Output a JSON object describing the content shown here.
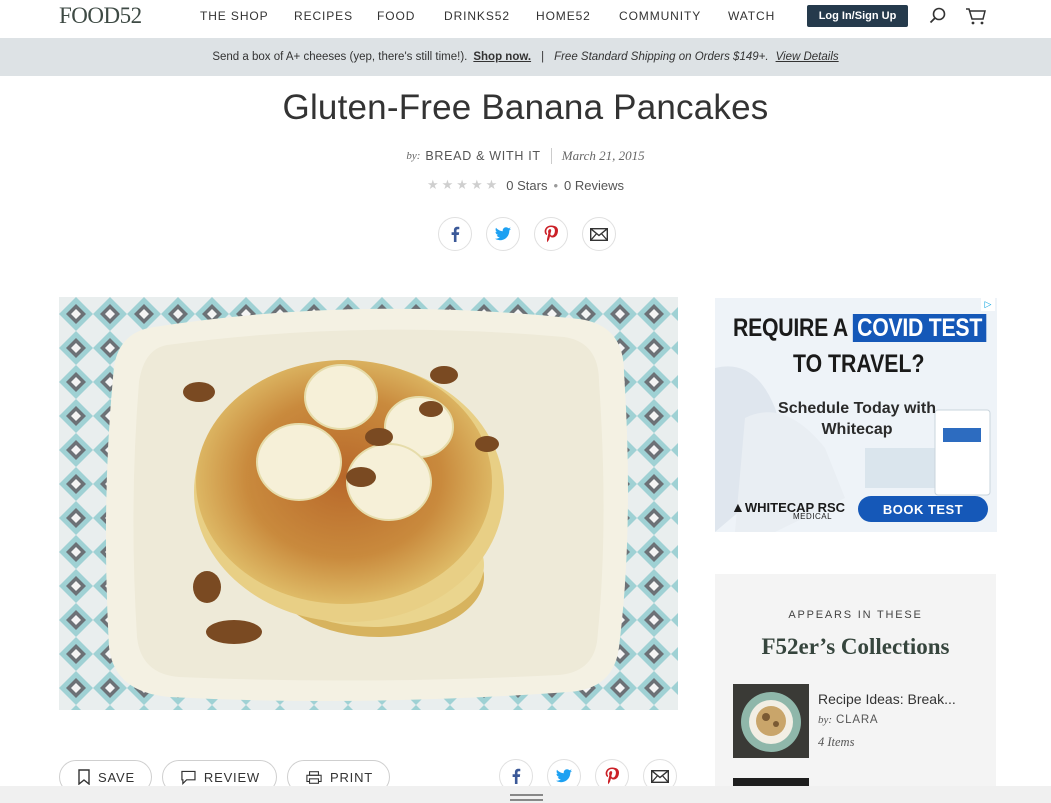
{
  "header": {
    "logo": "FOOD52",
    "nav": [
      "THE SHOP",
      "RECIPES",
      "FOOD",
      "DRINKS52",
      "HOME52",
      "COMMUNITY",
      "WATCH"
    ],
    "login_label": "Log In/Sign Up",
    "icons": [
      "search-icon",
      "cart-icon"
    ]
  },
  "promo": {
    "text": "Send a box of A+ cheeses (yep, there's still time!).",
    "link": "Shop now.",
    "separator": "|",
    "shipping": "Free Standard Shipping on Orders $149+.",
    "details_link": "View Details"
  },
  "recipe": {
    "title": "Gluten-Free Banana Pancakes",
    "by_label": "by:",
    "author": "BREAD & WITH IT",
    "date": "March 21, 2015",
    "stars_label": "0 Stars",
    "reviews_label": "0 Reviews",
    "rating_stars": 0
  },
  "actions": {
    "save": "SAVE",
    "review": "REVIEW",
    "print": "PRINT"
  },
  "ad": {
    "line1_prefix": "REQUIRE A",
    "line1_highlight": "COVID TEST",
    "line2": "TO TRAVEL?",
    "schedule": "Schedule Today with Whitecap",
    "brand": "WHITECAP RSC",
    "brand_sub": "MEDICAL",
    "cta": "BOOK TEST"
  },
  "collections": {
    "kicker": "APPEARS IN THESE",
    "title": "F52er’s Collections",
    "item_title": "Recipe Ideas: Break...",
    "item_by_label": "by:",
    "item_author": "CLARA",
    "item_count": "4 Items"
  },
  "colors": {
    "login_bg": "#253a4c",
    "promo_bg": "#dde2e5",
    "facebook": "#3b5998",
    "twitter": "#1da1f2",
    "pinterest": "#cb2027",
    "ad_blue": "#1558b8"
  }
}
